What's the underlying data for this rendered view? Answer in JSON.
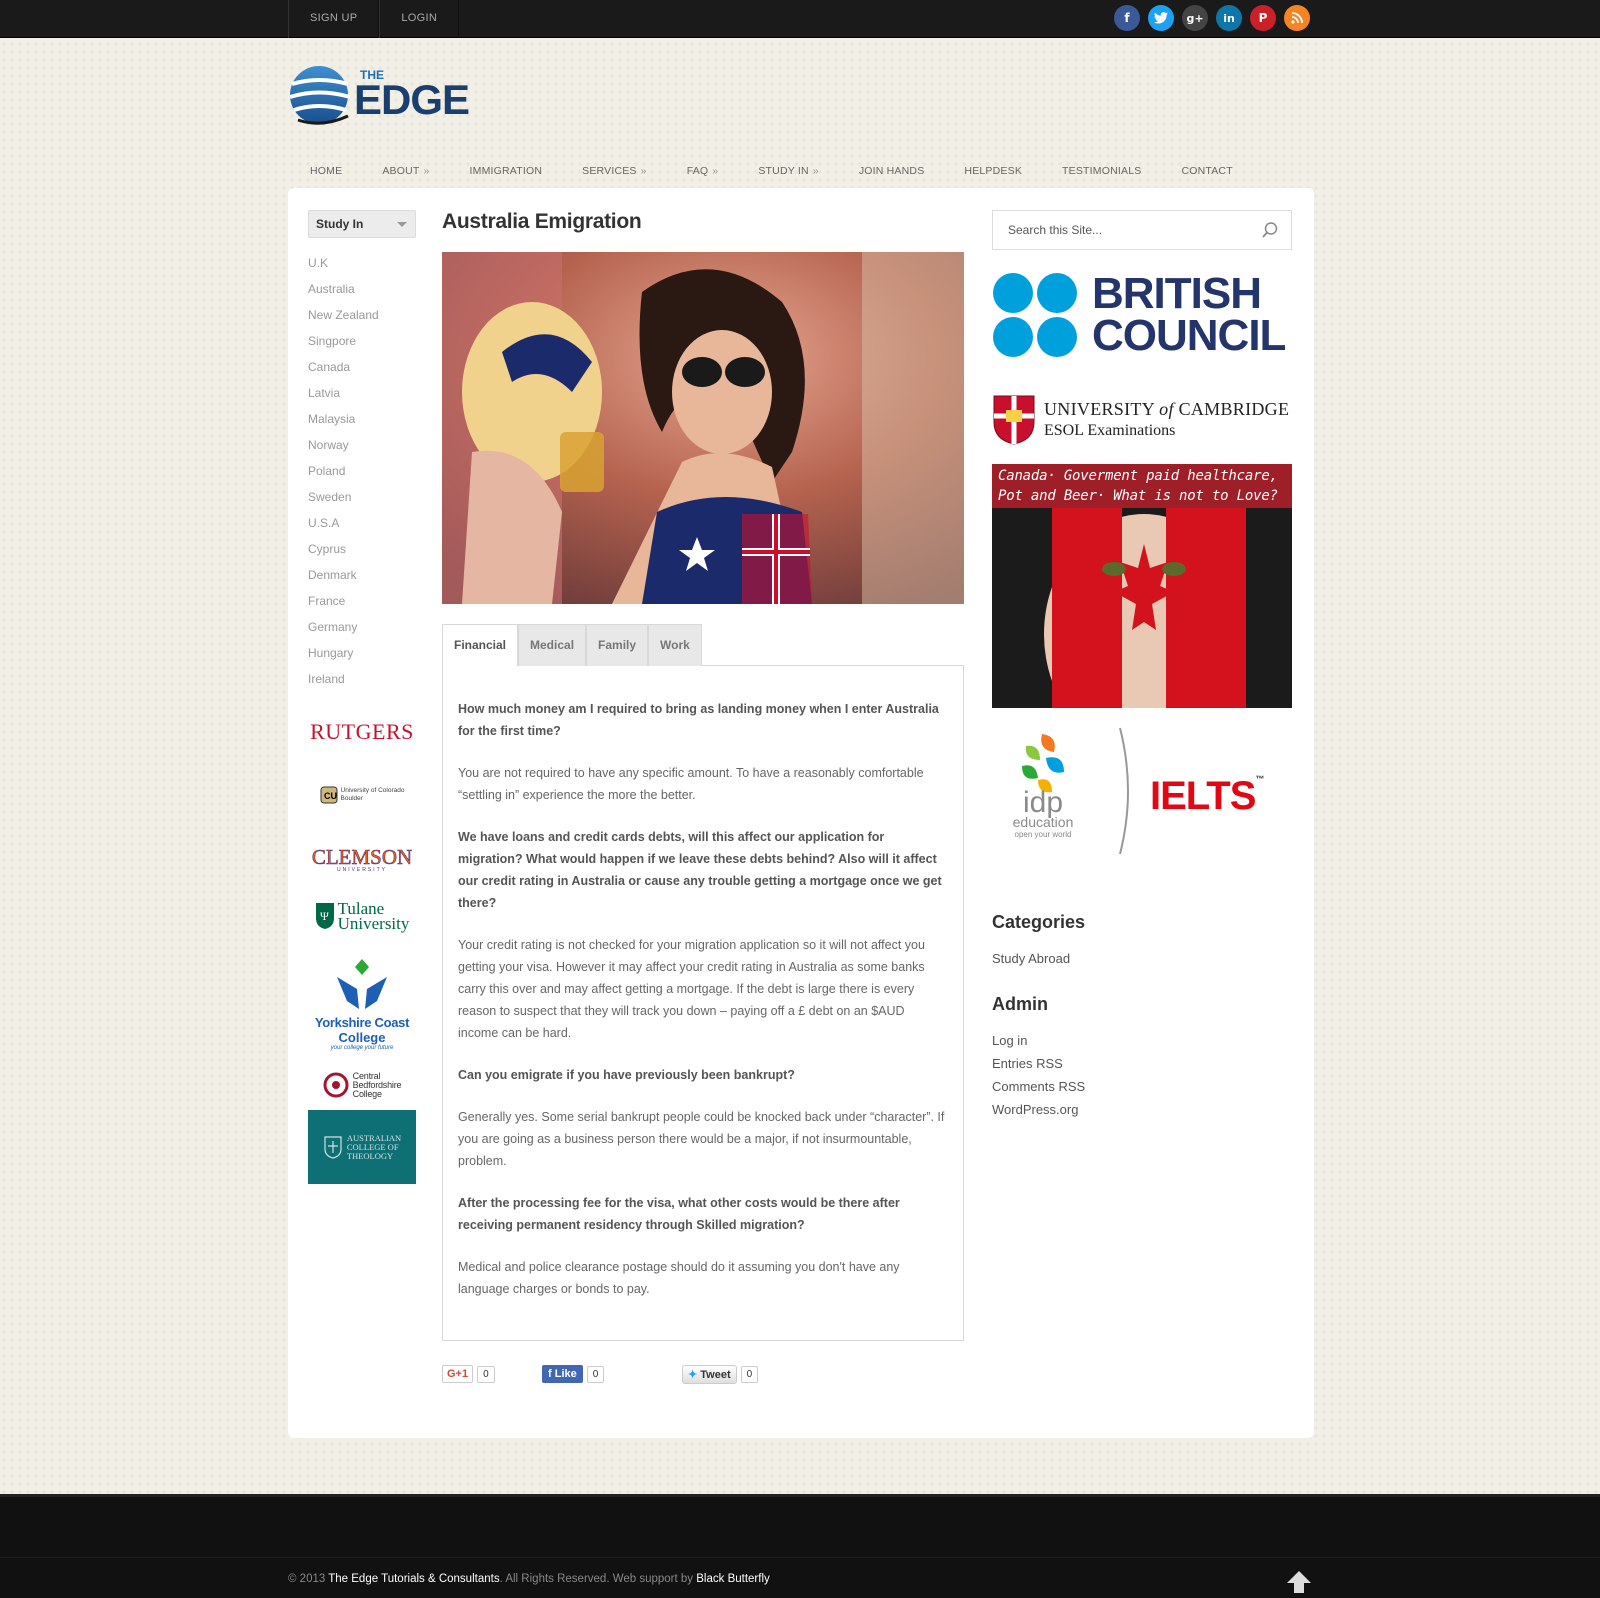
{
  "topbar": {
    "signup": "SIGN UP",
    "login": "LOGIN"
  },
  "social_icons": [
    "facebook-icon",
    "twitter-icon",
    "google-plus-icon",
    "linkedin-icon",
    "pinterest-icon",
    "rss-icon"
  ],
  "logo": {
    "top": "THE",
    "main": "EDGE"
  },
  "nav": [
    {
      "label": "HOME",
      "has_sub": false
    },
    {
      "label": "ABOUT",
      "has_sub": true
    },
    {
      "label": "IMMIGRATION",
      "has_sub": false
    },
    {
      "label": "SERVICES",
      "has_sub": true
    },
    {
      "label": "FAQ",
      "has_sub": true
    },
    {
      "label": "STUDY IN",
      "has_sub": true
    },
    {
      "label": "JOIN HANDS",
      "has_sub": false
    },
    {
      "label": "HELPDESK",
      "has_sub": false
    },
    {
      "label": "TESTIMONIALS",
      "has_sub": false
    },
    {
      "label": "CONTACT",
      "has_sub": false
    }
  ],
  "nav_arrow": "»",
  "sidebar": {
    "select_label": "Study In",
    "countries": [
      "U.K",
      "Australia",
      "New Zealand",
      "Singpore",
      "Canada",
      "Latvia",
      "Malaysia",
      "Norway",
      "Poland",
      "Sweden",
      "U.S.A",
      "Cyprus",
      "Denmark",
      "France",
      "Germany",
      "Hungary",
      "Ireland"
    ],
    "logos": {
      "rutgers": "RUTGERS",
      "colorado": "University of Colorado\nBoulder",
      "clemson": "CLEMSON",
      "clemson_sub": "UNIVERSITY",
      "tulane_1": "Tulane",
      "tulane_2": "University",
      "yorkshire_1": "Yorkshire Coast",
      "yorkshire_2": "College",
      "yorkshire_3": "your college your future",
      "bedford_1": "Central",
      "bedford_2": "Bedfordshire",
      "bedford_3": "College",
      "act_1": "AUSTRALIAN",
      "act_2": "COLLEGE OF",
      "act_3": "THEOLOGY"
    }
  },
  "content": {
    "title": "Australia Emigration",
    "tabs": [
      "Financial",
      "Medical",
      "Family",
      "Work"
    ],
    "active_tab": "Financial",
    "paragraphs": [
      {
        "q": true,
        "text": "How much money am I required to bring as landing money when I enter Australia for the first time?"
      },
      {
        "q": false,
        "text": "You are not required to have any specific amount. To have a reasonably comfortable “settling in” experience the more the better."
      },
      {
        "q": true,
        "text": "We have loans and credit cards debts, will this affect our application for migration? What would happen if we leave these debts behind? Also will it affect our credit rating in Australia or cause any trouble getting a mortgage once we get there?"
      },
      {
        "q": false,
        "text": "Your credit rating is not checked for your migration application so it will not affect you getting your visa. However it may affect your credit rating in Australia as some banks carry this over and may affect getting a mortgage. If the debt is large there is every reason to suspect that they will track you down – paying off a £ debt on an $AUD income can be hard."
      },
      {
        "q": true,
        "text": "Can you emigrate if you have previously been bankrupt?"
      },
      {
        "q": false,
        "text": "Generally yes. Some serial bankrupt people could be knocked back under “character”. If you are going as a business person there would be a major, if not insurmountable, problem."
      },
      {
        "q": true,
        "text": "After the processing fee for the visa, what other costs would be there after receiving permanent residency through Skilled migration?"
      },
      {
        "q": false,
        "text": "Medical and police clearance postage should do it assuming you don't have any language charges or bonds to pay."
      }
    ],
    "share": {
      "gplus": "G+1",
      "gplus_count": "0",
      "like": "Like",
      "like_count": "0",
      "tweet": "Tweet",
      "tweet_count": "0"
    }
  },
  "right": {
    "search_placeholder": "Search this Site...",
    "british_council_1": "BRITISH",
    "british_council_2": "COUNCIL",
    "cambridge_1a": "UNIVERSITY",
    "cambridge_1b": "of",
    "cambridge_1c": "CAMBRIDGE",
    "cambridge_2": "ESOL Examinations",
    "canada_ad_1": "Canada· Goverment paid healthcare,",
    "canada_ad_2": "Pot and Beer· What is not to Love?",
    "idp_1": "idp",
    "idp_2": "education",
    "idp_3": "open your world",
    "ielts": "IELTS",
    "ielts_tm": "™",
    "categories_title": "Categories",
    "categories": [
      "Study Abroad"
    ],
    "admin_title": "Admin",
    "admin_links": [
      "Log in",
      "Entries RSS",
      "Comments RSS",
      "WordPress.org"
    ]
  },
  "footer": {
    "copy_prefix": "© 2013 ",
    "company": "The Edge Tutorials & Consultants",
    "mid": ". All Rights Reserved. Web support by ",
    "support": "Black Butterfly"
  },
  "colors": {
    "accent_blue": "#1f6fb5",
    "dark": "#1a1a1a",
    "british_council_blue": "#00a0dc",
    "ielts_red": "#e30613"
  }
}
